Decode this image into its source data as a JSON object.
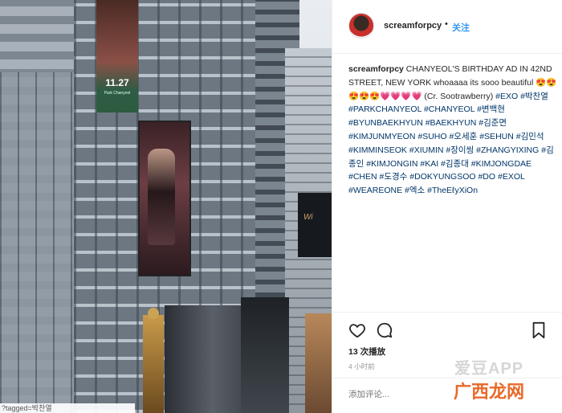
{
  "photo": {
    "billboard_date": "11.27",
    "billboard_name": "Park Chanyeol",
    "right_sign_text": "Wi",
    "tag_overlay": "?tagged=박찬열"
  },
  "post": {
    "username": "screamforpcy",
    "separator": "•",
    "follow_label": "关注",
    "caption": {
      "username": "screamforpcy",
      "text": "CHANYEOL'S BIRTHDAY AD IN 42ND STREET, NEW YORK whoaaaa its sooo beautiful 😍😍😍😍😍💗💗💗💗 (Cr. Sootrawberry)",
      "hashtags": [
        "#EXO",
        "#박찬열",
        "#PARKCHANYEOL",
        "#CHANYEOL",
        "#변백현",
        "#BYUNBAEKHYUN",
        "#BAEKHYUN",
        "#김준면",
        "#KIMJUNMYEON",
        "#SUHO",
        "#오세훈",
        "#SEHUN",
        "#김민석",
        "#KIMMINSEOK",
        "#XIUMIN",
        "#장이씽",
        "#ZHANGYIXING",
        "#김종인",
        "#KIMJONGIN",
        "#KAI",
        "#김종대",
        "#KIMJONGDAE",
        "#CHEN",
        "#도경수",
        "#DOKYUNGSOO",
        "#DO",
        "#EXOL",
        "#WEAREONE",
        "#엑소",
        "#TheEℓyXiOn"
      ]
    },
    "likes": "13 次播放",
    "time": "4 小时前",
    "comment_placeholder": "添加评论..."
  },
  "icons": {
    "like": "heart-icon",
    "comment": "comment-icon",
    "save": "bookmark-icon"
  },
  "watermark": {
    "line1": "爱豆APP",
    "line2": "广西龙网"
  },
  "colors": {
    "link": "#3897f0",
    "hashtag": "#003569",
    "muted": "#999999",
    "text": "#262626"
  }
}
